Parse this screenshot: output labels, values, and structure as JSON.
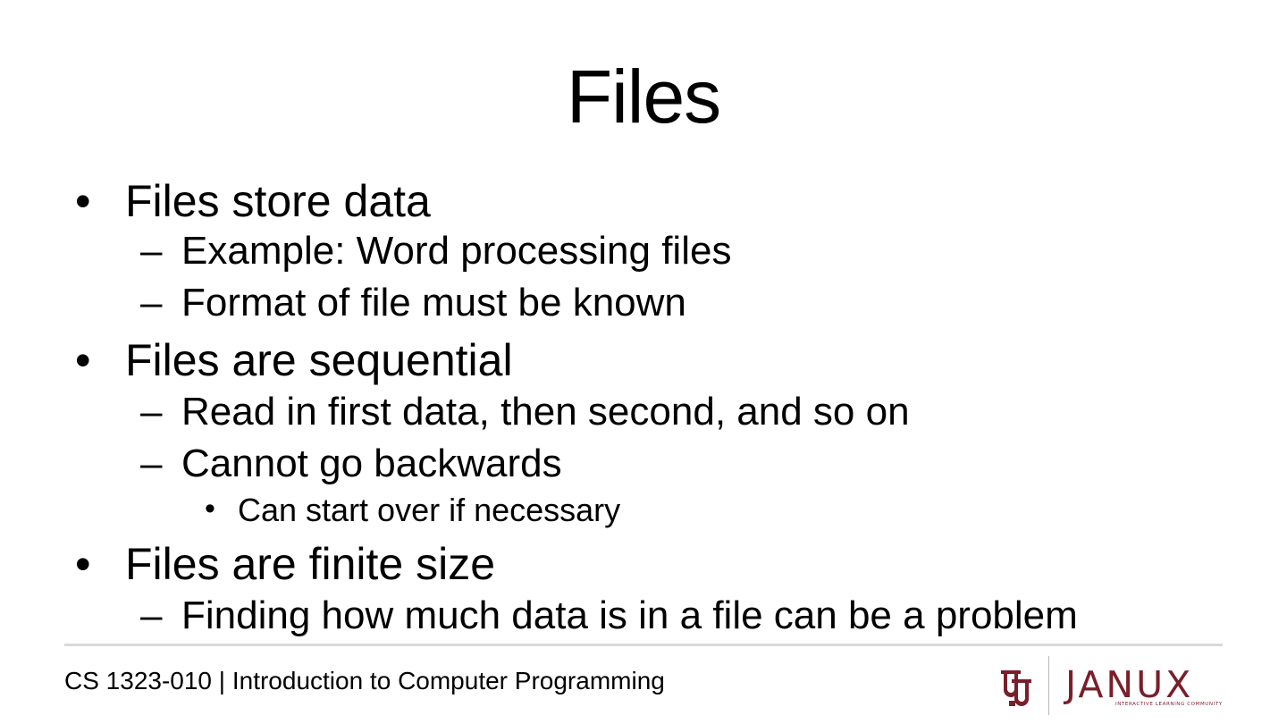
{
  "slide": {
    "title": "Files",
    "bullets": [
      {
        "text": "Files store data",
        "subs": [
          {
            "text": "Example: Word processing files"
          },
          {
            "text": "Format of file must be known"
          }
        ]
      },
      {
        "text": "Files are sequential",
        "subs": [
          {
            "text": "Read in first data, then second, and so on"
          },
          {
            "text": "Cannot go backwards",
            "subs": [
              {
                "text": "Can start over if necessary"
              }
            ]
          }
        ]
      },
      {
        "text": "Files are finite size",
        "subs": [
          {
            "text": "Finding how much data is in a file can be a problem"
          }
        ]
      }
    ],
    "markers": {
      "level1": "•",
      "level2": "–",
      "level3": "•"
    }
  },
  "footer": {
    "course": "CS 1323-010 | Introduction to Computer Programming",
    "logo": {
      "ou_mark_icon": "ou-interlocking-logo",
      "brand": "JANUX",
      "tagline": "INTERACTIVE LEARNING COMMUNITY",
      "brand_color": "#7a1e2a"
    }
  },
  "colors": {
    "background": "#ffffff",
    "text": "#000000",
    "rule": "#d9d9d9"
  }
}
